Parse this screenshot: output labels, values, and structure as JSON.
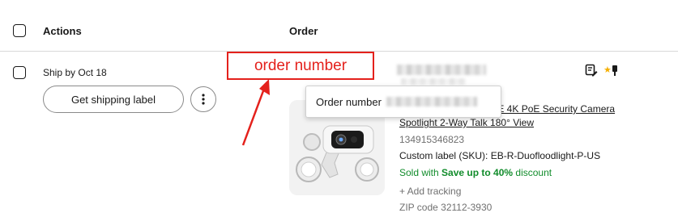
{
  "header": {
    "actions_label": "Actions",
    "order_label": "Order"
  },
  "row": {
    "ship_by": "Ship by Oct 18",
    "get_label_button": "Get shipping label",
    "more_button_icon": "vertical-dots-icon",
    "title_line1": "t PoE 4K PoE Security Camera",
    "title_line2": "Spotlight 2-Way Talk 180° View",
    "item_number": "134915346823",
    "sku": "Custom label (SKU): EB-R-Duofloodlight-P-US",
    "sold_prefix": "Sold with ",
    "sold_emphasis": "Save up to 40%",
    "sold_suffix": " discount",
    "add_tracking": "+ Add tracking",
    "zip_code": "ZIP code 32112-3930",
    "action_icons": [
      "note-edit-icon",
      "star-icon",
      "flag-icon"
    ]
  },
  "tooltip": {
    "label": "Order number"
  },
  "annotation": {
    "label": "order number",
    "color": "#e4211c"
  },
  "colors": {
    "sold_green": "#118c2b",
    "star_yellow": "#f5af02",
    "annotation_red": "#e4211c"
  }
}
